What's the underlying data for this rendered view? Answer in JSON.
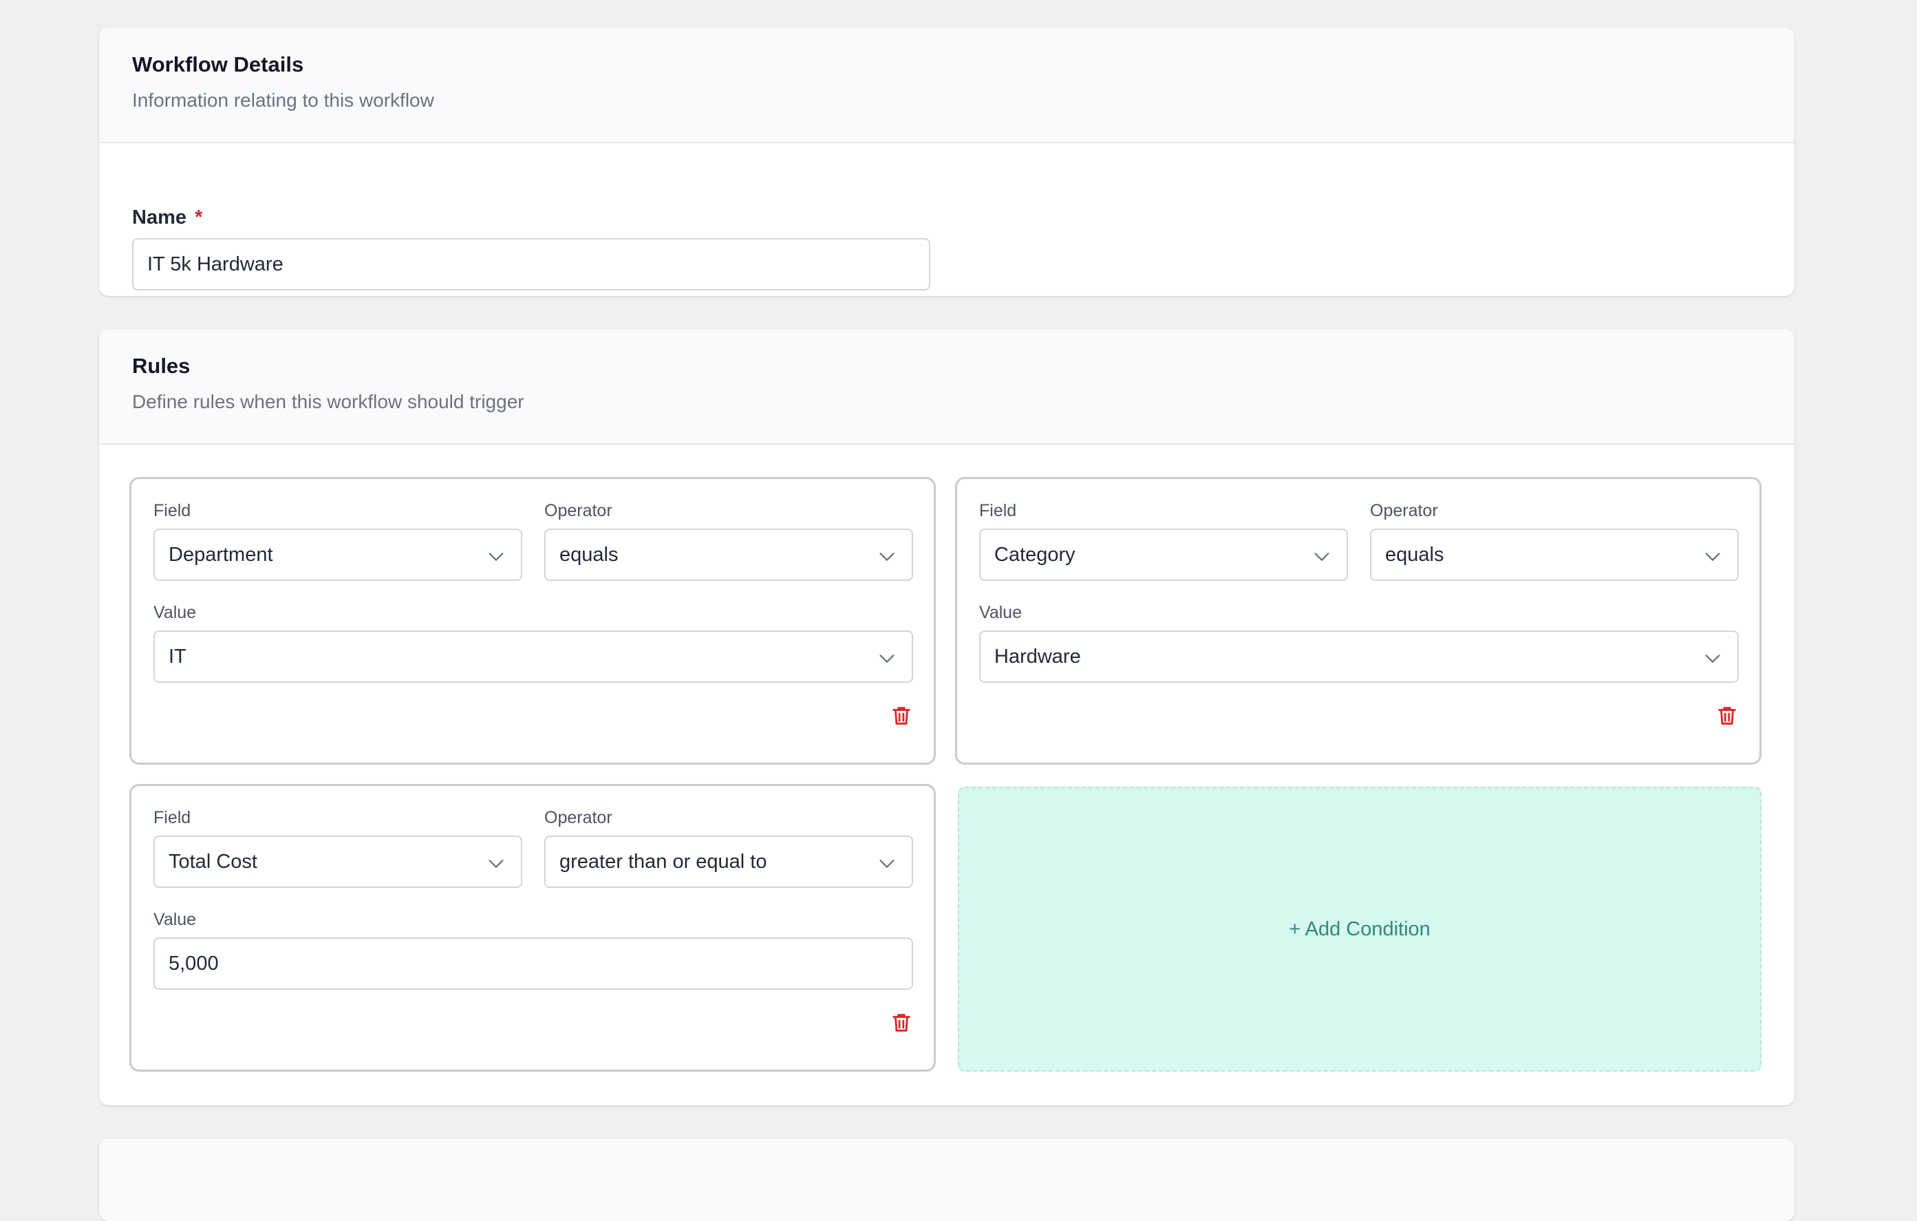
{
  "workflow_details": {
    "title": "Workflow Details",
    "subtitle": "Information relating to this workflow",
    "name_label": "Name",
    "required_mark": "*",
    "name_value": "IT 5k Hardware"
  },
  "rules": {
    "title": "Rules",
    "subtitle": "Define rules when this workflow should trigger",
    "field_label": "Field",
    "operator_label": "Operator",
    "value_label": "Value",
    "conditions": [
      {
        "field": "Department",
        "operator": "equals",
        "value": "IT",
        "value_type": "select"
      },
      {
        "field": "Category",
        "operator": "equals",
        "value": "Hardware",
        "value_type": "select"
      },
      {
        "field": "Total Cost",
        "operator": "greater than or equal to",
        "value": "5,000",
        "value_type": "input"
      }
    ],
    "add_condition_label": "+ Add Condition"
  },
  "colors": {
    "required": "#dc2626",
    "delete_icon": "#dc2626",
    "add_condition_bg": "#d5f8ef",
    "add_condition_text": "#2f8a74"
  },
  "icons": {
    "dropdown": "chevron-down-icon",
    "delete": "trash-icon"
  }
}
